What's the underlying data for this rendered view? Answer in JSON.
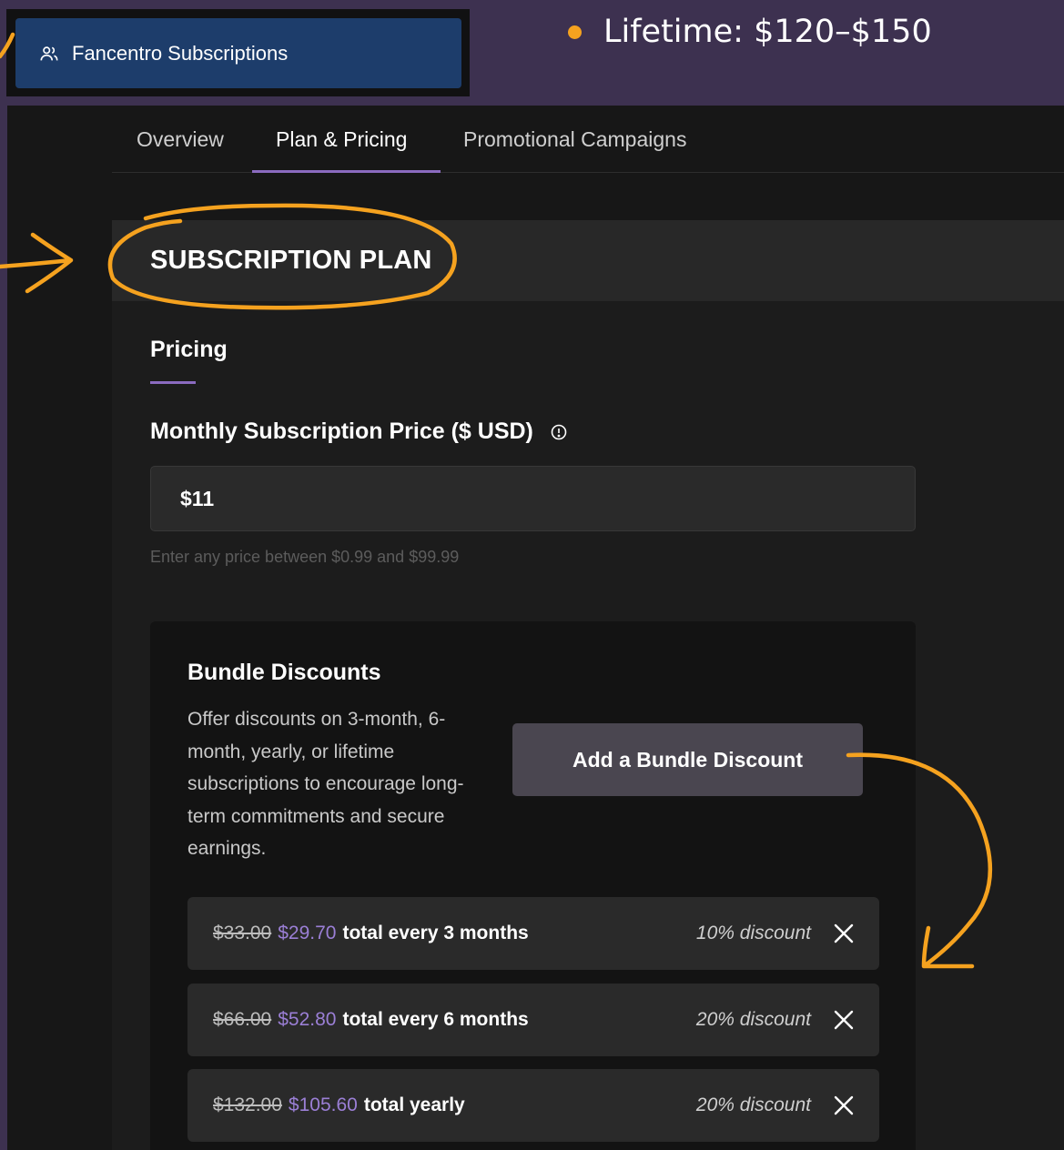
{
  "sidebar": {
    "active_item": {
      "label": "Fancentro Subscriptions",
      "icon": "users-icon"
    }
  },
  "note": {
    "bullet_text": "Lifetime: $120–$150"
  },
  "tabs": [
    {
      "label": "Overview"
    },
    {
      "label": "Plan & Pricing",
      "active": true
    },
    {
      "label": "Promotional Campaigns"
    }
  ],
  "plan": {
    "section_title": "SUBSCRIPTION PLAN",
    "pricing_tab": "Pricing",
    "price_label": "Monthly Subscription Price ($ USD)",
    "price_value": "$11",
    "price_helper": "Enter any price between $0.99 and $99.99"
  },
  "bundles": {
    "title": "Bundle Discounts",
    "description": "Offer discounts on 3-month, 6-month, yearly, or lifetime subscriptions to encourage long-term commitments and secure earnings.",
    "add_button": "Add a Bundle Discount",
    "items": [
      {
        "old_price": "$33.00",
        "new_price": "$29.70",
        "desc": "total every 3 months",
        "discount": "10% discount"
      },
      {
        "old_price": "$66.00",
        "new_price": "$52.80",
        "desc": "total every 6 months",
        "discount": "20% discount"
      },
      {
        "old_price": "$132.00",
        "new_price": "$105.60",
        "desc": "total yearly",
        "discount": "20% discount"
      }
    ]
  },
  "colors": {
    "accent_purple": "#8b6bc0",
    "annotation_orange": "#f5a21f",
    "nav_blue": "#1d3d6b"
  }
}
